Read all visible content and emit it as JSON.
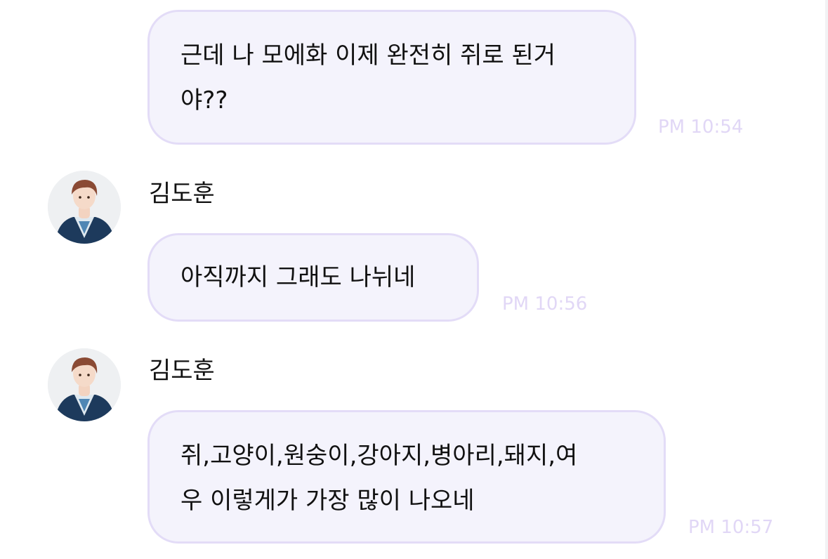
{
  "messages": [
    {
      "type": "outgoing",
      "lines": [
        "근데 나 모에화 이제 완전히 쥐로 된거",
        "야??"
      ],
      "time": "PM 10:54"
    },
    {
      "type": "incoming",
      "sender": "김도훈",
      "lines": [
        "아직까지 그래도 나뉘네"
      ],
      "time": "PM 10:56"
    },
    {
      "type": "incoming",
      "sender": "김도훈",
      "lines": [
        "쥐,고양이,원숭이,강아지,병아리,돼지,여",
        "우 이렇게가 가장 많이 나오네"
      ],
      "time": "PM 10:57"
    }
  ],
  "colors": {
    "bubble_fill": "#f4f3fc",
    "bubble_border": "#e3dcf7",
    "timestamp": "#e1d7f6",
    "text": "#111111"
  },
  "icons": {
    "avatar": "profile-photo-avatar"
  }
}
